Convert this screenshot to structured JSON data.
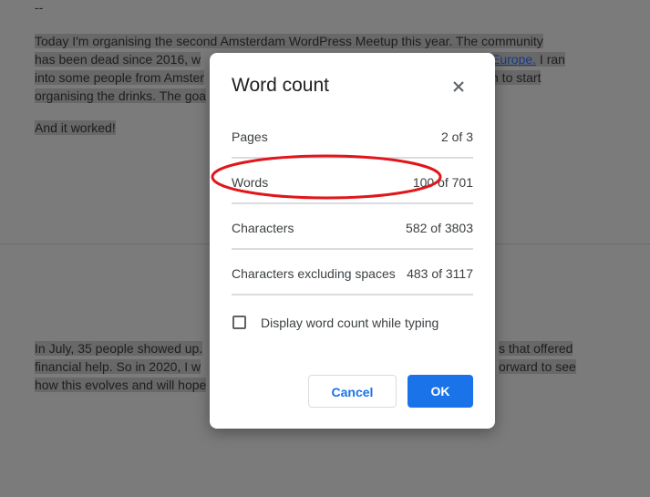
{
  "document": {
    "dash": "--",
    "para1_lines": [
      "Today I'm organising the second Amsterdam WordPress Meetup this year. The community",
      "has been dead since 2016, w",
      "into some people from Amster",
      "organising the drinks. The goa"
    ],
    "para1_link": "Europe.",
    "para1_after_link": " I ran",
    "para1_line3_tail": "n to start",
    "para2": "And it worked!",
    "para3_lines": [
      "In July, 35 people showed up.",
      "financial help. So in 2020, I w",
      "how this evolves and will hope"
    ],
    "para3_tails": [
      "s that offered",
      "orward to see"
    ]
  },
  "dialog": {
    "title": "Word count",
    "rows": [
      {
        "label": "Pages",
        "value": "2 of 3"
      },
      {
        "label": "Words",
        "value": "100 of 701"
      },
      {
        "label": "Characters",
        "value": "582 of 3803"
      },
      {
        "label": "Characters excluding spaces",
        "value": "483 of 3117"
      }
    ],
    "checkbox_label": "Display word count while typing",
    "cancel_label": "Cancel",
    "ok_label": "OK"
  },
  "colors": {
    "accent": "#1a73e8",
    "annotation": "#e0161b"
  }
}
